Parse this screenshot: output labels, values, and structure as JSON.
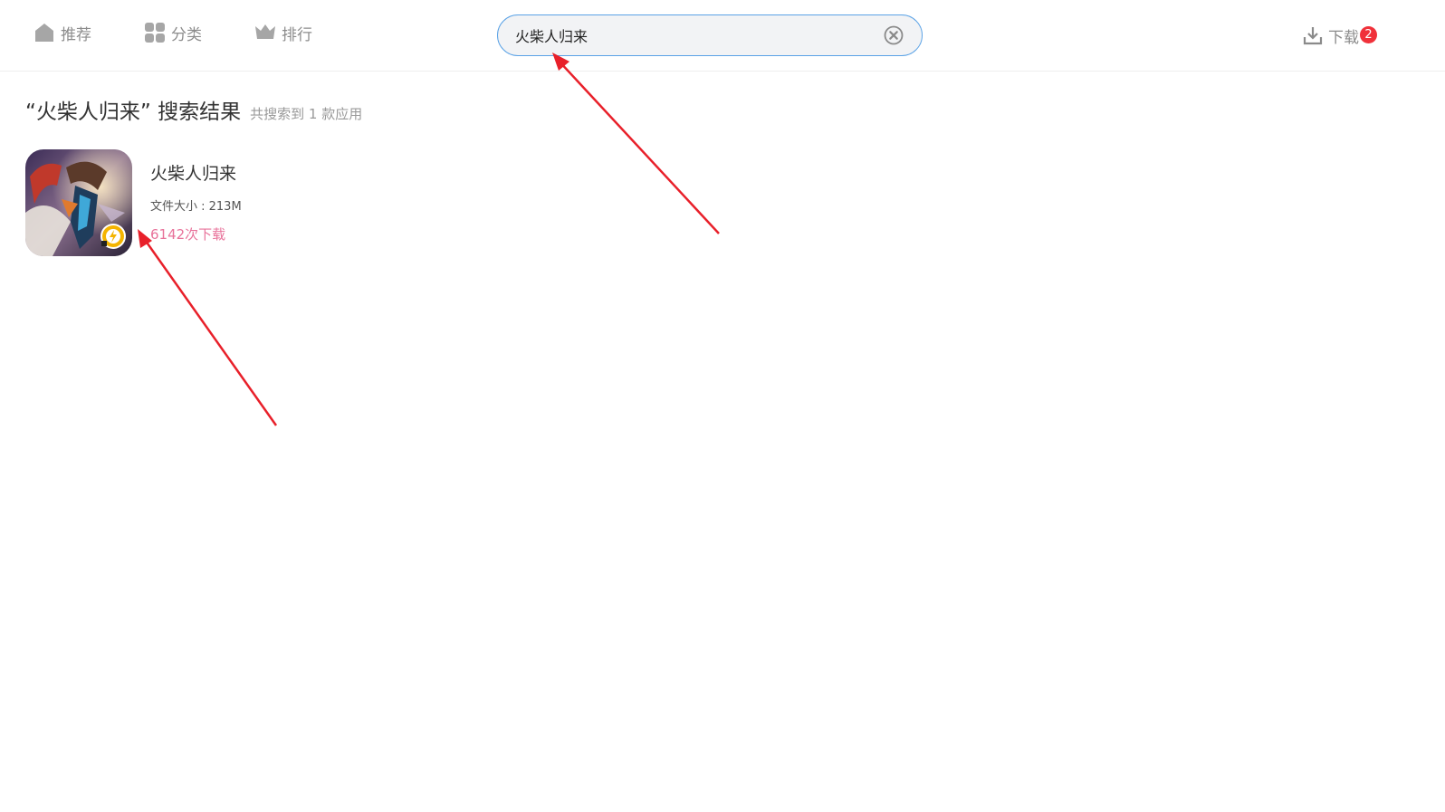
{
  "nav": {
    "items": [
      {
        "label": "推荐",
        "icon": "home-icon"
      },
      {
        "label": "分类",
        "icon": "grid-icon"
      },
      {
        "label": "排行",
        "icon": "crown-icon"
      }
    ]
  },
  "search": {
    "value": "火柴人归来",
    "clear_icon": "clear-icon"
  },
  "downloads": {
    "label": "下载",
    "count": "2",
    "icon": "download-icon"
  },
  "results": {
    "title": "“火柴人归来” 搜索结果",
    "count_text": "共搜索到 1 款应用",
    "items": [
      {
        "name": "火柴人归来",
        "size": "文件大小 : 213M",
        "downloads": "6142次下载",
        "badge_icon": "speed-badge-icon"
      }
    ]
  },
  "colors": {
    "accent_blue": "#5aa2e6",
    "badge_red": "#f0313a",
    "downloads_pink": "#e8729a",
    "annotation_red": "#e8202a"
  }
}
